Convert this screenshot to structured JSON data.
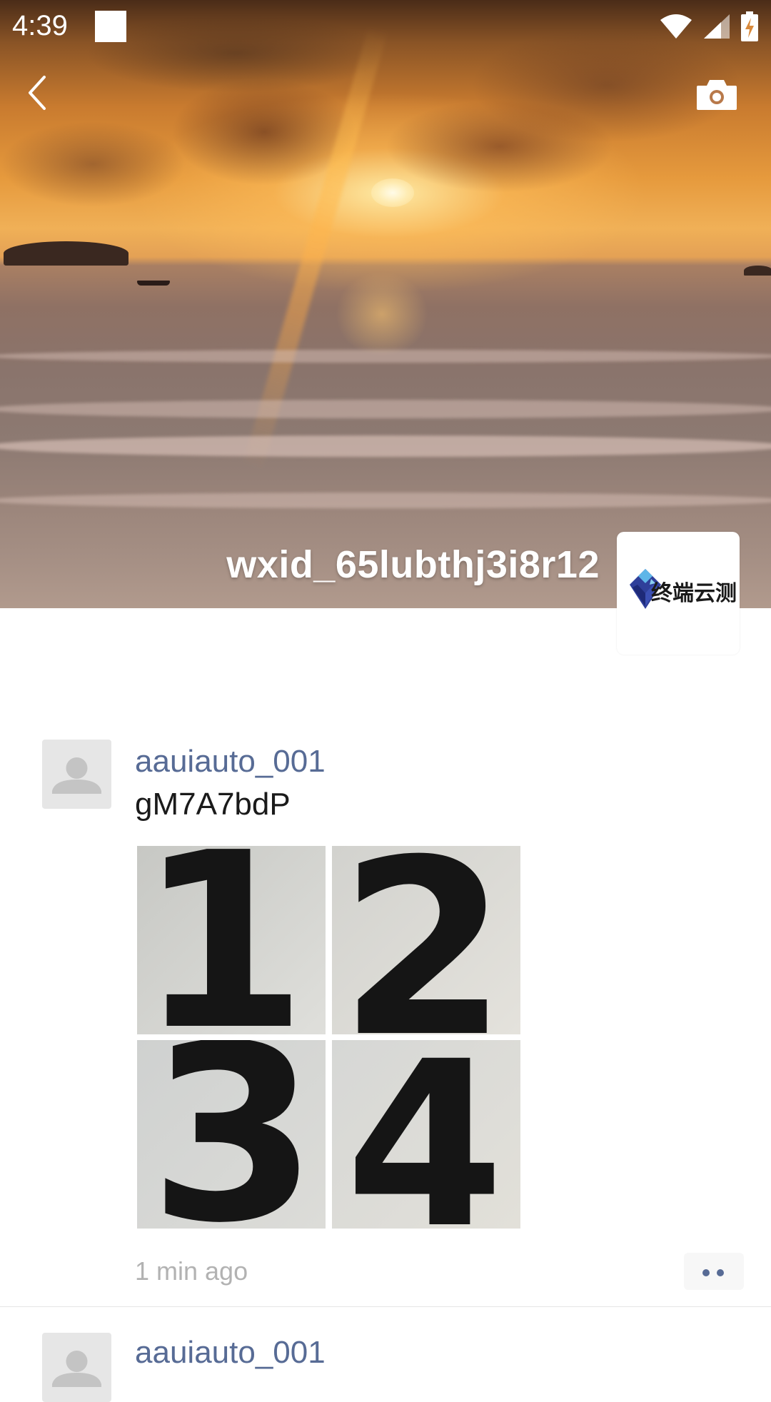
{
  "status_bar": {
    "time": "4:39"
  },
  "cover": {
    "profile_name": "wxid_65lubthj3i8r12",
    "avatar_logo_text": "终端云测"
  },
  "posts": [
    {
      "author": "aauiauto_001",
      "text": "gM7A7bdP",
      "images": [
        {
          "label": "1"
        },
        {
          "label": "2"
        },
        {
          "label": "3"
        },
        {
          "label": "4"
        }
      ],
      "time": "1 min ago"
    },
    {
      "author": "aauiauto_001"
    }
  ],
  "icons": {
    "back": "back-arrow-icon",
    "camera": "camera-icon",
    "wifi": "wifi-icon",
    "signal": "signal-icon",
    "battery": "battery-charging-icon",
    "more": "more-dots-icon",
    "avatar_placeholder": "person-placeholder-icon"
  },
  "colors": {
    "author_link": "#576b95",
    "timestamp": "#b2b2b2",
    "divider": "#e5e5e5"
  }
}
